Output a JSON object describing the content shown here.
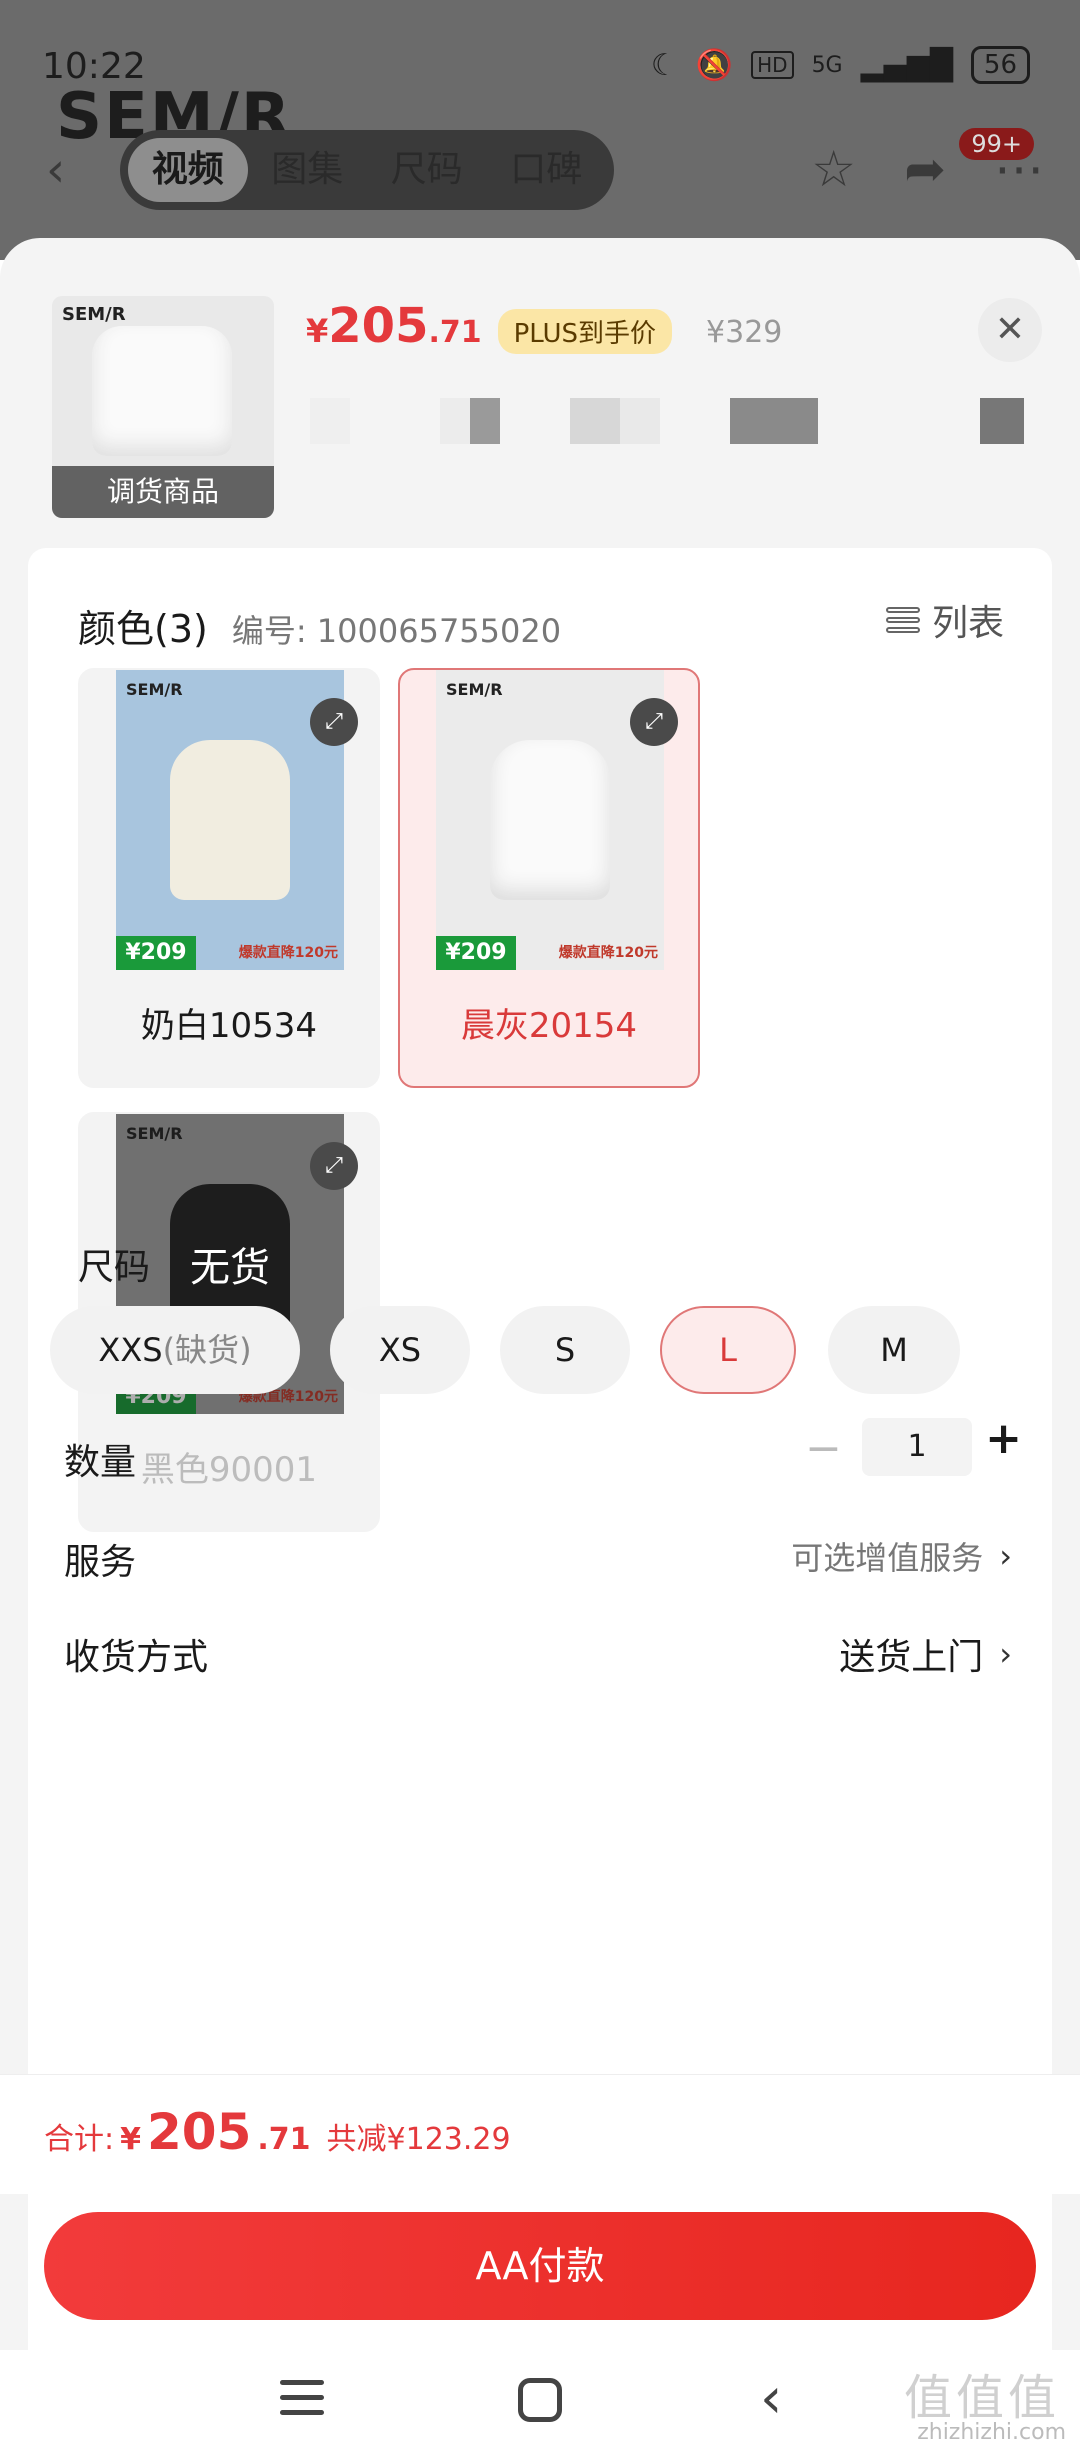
{
  "status_bar": {
    "time": "10:22",
    "network": "5G",
    "battery": "56",
    "hd": "HD"
  },
  "background_page": {
    "brand": "SEM/R",
    "tabs": [
      "视频",
      "图集",
      "尺码",
      "口碑"
    ],
    "active_tab": "视频",
    "badge": "99+"
  },
  "product": {
    "thumb_brand": "SEM/R",
    "thumb_label": "调货商品",
    "price_symbol": "¥",
    "price_int": "205",
    "price_dec": ".71",
    "plus_tag": "PLUS到手价",
    "original_price": "¥329"
  },
  "color_section": {
    "title": "颜色(3)",
    "code": "编号: 100065755020",
    "list_toggle": "列表",
    "swatches": [
      {
        "name": "奶白10534",
        "brand": "SEM/R",
        "price": "¥209",
        "tag": "爆款直降120元",
        "state": "normal"
      },
      {
        "name": "晨灰20154",
        "brand": "SEM/R",
        "price": "¥209",
        "tag": "爆款直降120元",
        "state": "selected"
      },
      {
        "name": "黑色90001",
        "brand": "SEM/R",
        "price": "¥209",
        "tag": "爆款直降120元",
        "state": "disabled",
        "overlay": "无货"
      }
    ]
  },
  "size_section": {
    "title": "尺码",
    "chips": [
      {
        "label": "XXS",
        "suffix": "(缺货)"
      },
      {
        "label": "XS"
      },
      {
        "label": "S"
      },
      {
        "label": "L",
        "selected": true
      },
      {
        "label": "M"
      }
    ]
  },
  "quantity": {
    "label": "数量",
    "value": "1"
  },
  "service": {
    "label": "服务",
    "value": "可选增值服务"
  },
  "delivery": {
    "label": "收货方式",
    "value": "送货上门"
  },
  "summary": {
    "label": "合计:",
    "symbol": "¥",
    "int": "205",
    "dec": ".71",
    "saved": "共减¥123.29"
  },
  "pay_button": "AA付款",
  "watermark": "zhizhizhi.com",
  "watermark_logo": "值值值",
  "colors": {
    "accent": "#e4393c",
    "plus_bg": "#fbe6a6",
    "selected_bg": "#fdebeb"
  }
}
